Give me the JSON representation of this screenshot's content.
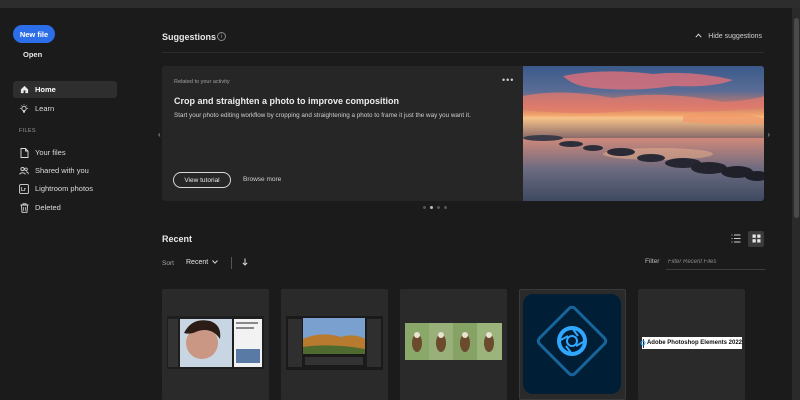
{
  "sidebar": {
    "new_file": "New file",
    "open": "Open",
    "nav": [
      {
        "label": "Home",
        "icon": "home-icon"
      },
      {
        "label": "Learn",
        "icon": "lightbulb-icon"
      }
    ],
    "files_section": "FILES",
    "files": [
      {
        "label": "Your files",
        "icon": "file-icon"
      },
      {
        "label": "Shared with you",
        "icon": "people-icon"
      },
      {
        "label": "Lightroom photos",
        "icon": "lightroom-icon"
      },
      {
        "label": "Deleted",
        "icon": "trash-icon"
      }
    ]
  },
  "suggestions": {
    "title": "Suggestions",
    "hide_label": "Hide suggestions",
    "card": {
      "kicker": "Related to your activity",
      "title": "Crop and straighten a photo to improve composition",
      "description": "Start your photo editing workflow by cropping and straightening a photo to frame it just the way you want it.",
      "primary_button": "View tutorial",
      "secondary_link": "Browse more"
    },
    "pager_count": 4,
    "pager_active": 2
  },
  "recent": {
    "title": "Recent",
    "sort_label": "Sort",
    "sort_value": "Recent",
    "filter_label": "Filter",
    "filter_placeholder": "Filter Recent Files",
    "thumbnails": [
      {
        "label": ""
      },
      {
        "label": ""
      },
      {
        "label": ""
      },
      {
        "label": ""
      },
      {
        "label": "Adobe Photoshop Elements 2022"
      }
    ]
  },
  "colors": {
    "accent": "#2c6ee8",
    "background": "#1b1b1b",
    "card": "#262626"
  }
}
